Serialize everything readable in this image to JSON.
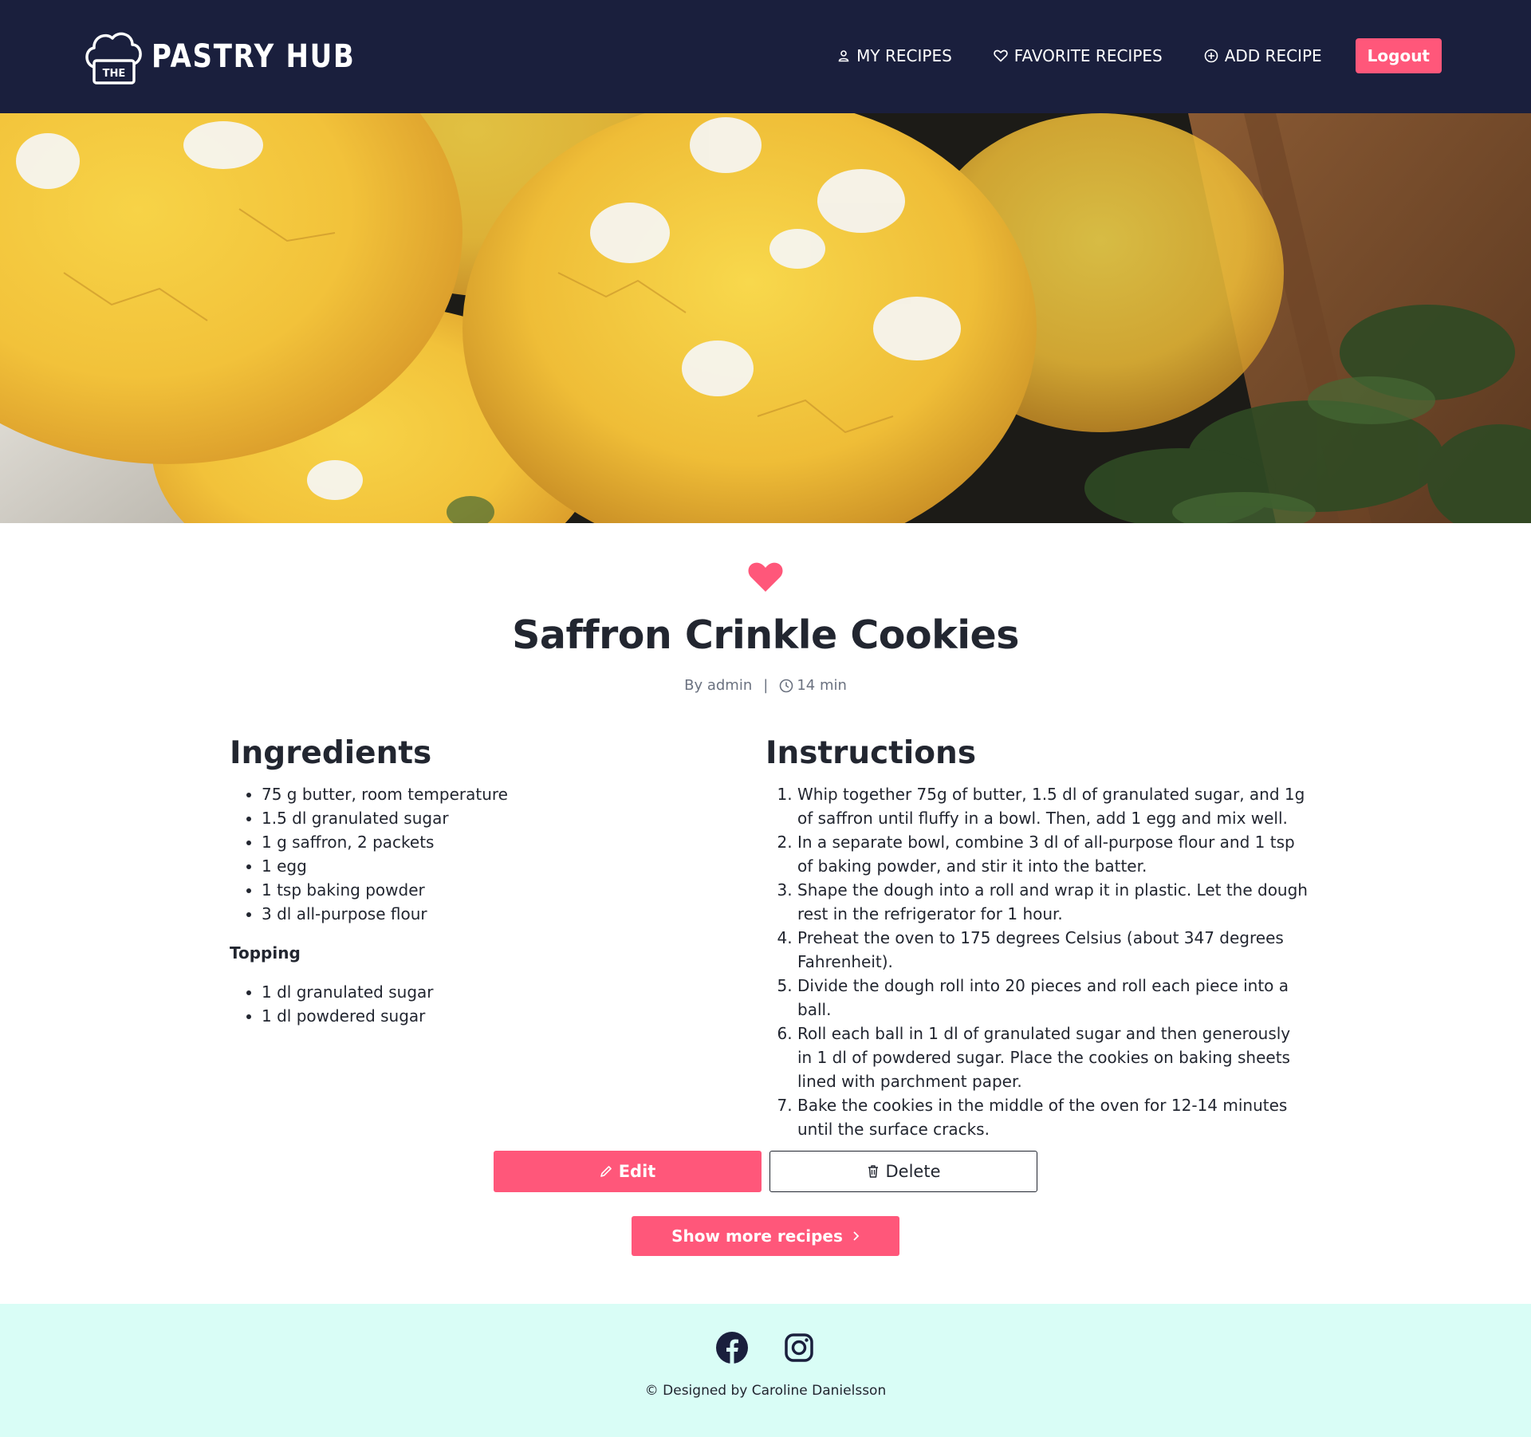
{
  "header": {
    "brand_small": "THE",
    "brand_name": "PASTRY HUB",
    "nav": {
      "my_recipes": "MY RECIPES",
      "favorite_recipes": "FAVORITE RECIPES",
      "add_recipe": "ADD RECIPE",
      "logout": "Logout"
    }
  },
  "recipe": {
    "title": "Saffron Crinkle Cookies",
    "author": "By admin",
    "separator": "|",
    "time": "14 min",
    "ingredients_title": "Ingredients",
    "ingredients": [
      "75 g butter, room temperature",
      "1.5 dl granulated sugar",
      "1 g saffron, 2 packets",
      "1 egg",
      "1 tsp baking powder",
      "3 dl all-purpose flour"
    ],
    "topping_title": "Topping",
    "topping": [
      "1 dl granulated sugar",
      "1 dl powdered sugar"
    ],
    "instructions_title": "Instructions",
    "instructions": [
      "Whip together 75g of butter, 1.5 dl of granulated sugar, and 1g of saffron until fluffy in a bowl. Then, add 1 egg and mix well.",
      "In a separate bowl, combine 3 dl of all-purpose flour and 1 tsp of baking powder, and stir it into the batter.",
      "Shape the dough into a roll and wrap it in plastic. Let the dough rest in the refrigerator for 1 hour.",
      "Preheat the oven to 175 degrees Celsius (about 347 degrees Fahrenheit).",
      "Divide the dough roll into 20 pieces and roll each piece into a ball.",
      "Roll each ball in 1 dl of granulated sugar and then generously in 1 dl of powdered sugar. Place the cookies on baking sheets lined with parchment paper.",
      "Bake the cookies in the middle of the oven for 12-14 minutes until the surface cracks."
    ]
  },
  "actions": {
    "edit": "Edit",
    "delete": "Delete",
    "show_more": "Show more recipes"
  },
  "footer": {
    "copyright": "© Designed by Caroline Danielsson"
  },
  "colors": {
    "navbar": "#1a1f3d",
    "accent": "#ff577a",
    "footer": "#d9fdf6"
  }
}
